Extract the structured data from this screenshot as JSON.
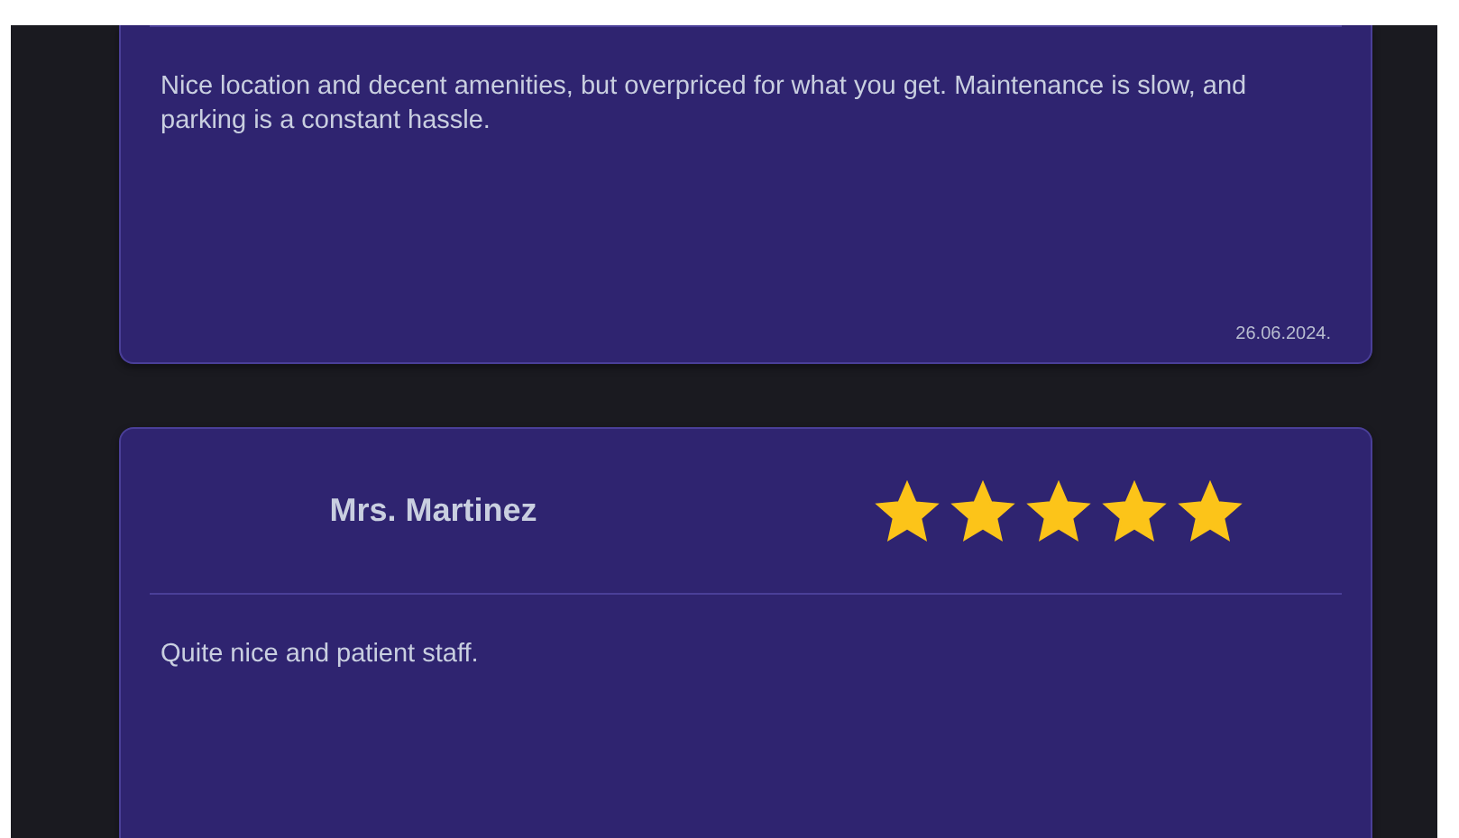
{
  "reviews": [
    {
      "text": "Nice location and decent amenities, but overpriced for what you get. Maintenance is slow, and parking is a constant hassle.",
      "date": "26.06.2024."
    },
    {
      "name": "Mrs. Martinez",
      "stars": 5,
      "text": "Quite nice and patient staff."
    }
  ]
}
